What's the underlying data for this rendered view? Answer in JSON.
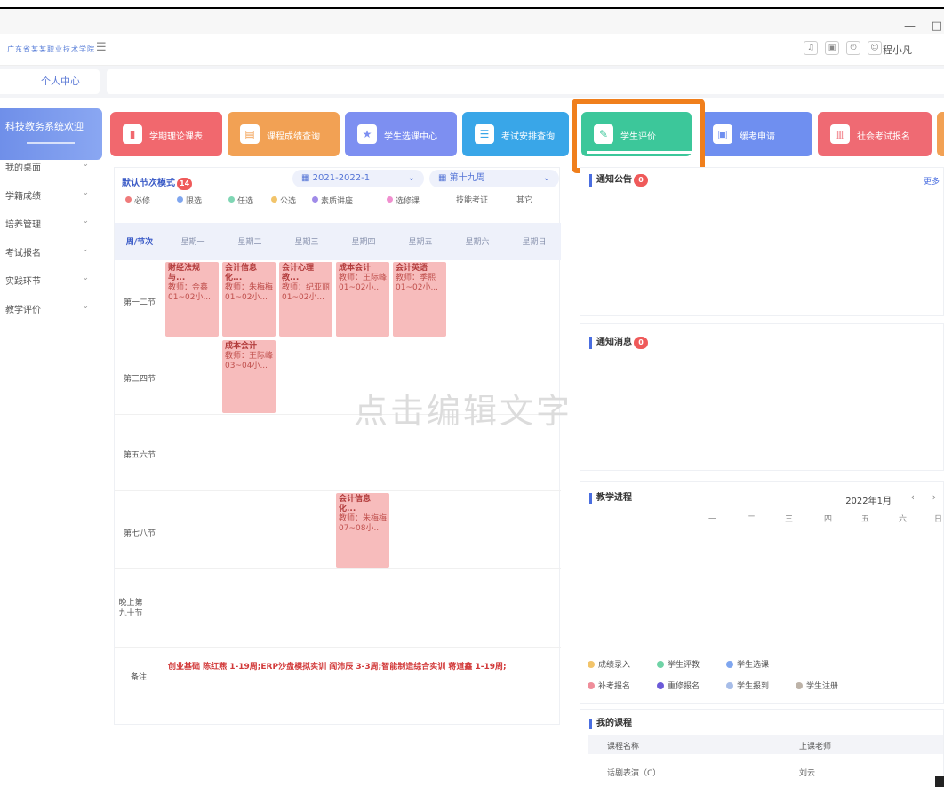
{
  "window": {
    "minimize": "—",
    "maximize": "□"
  },
  "app": {
    "logo_text": "广东省某某职业技术学院",
    "username": "程小凡",
    "toolbar_icons": [
      "bell-icon",
      "lock-icon",
      "power-icon",
      "user-icon"
    ]
  },
  "tabs": {
    "active": "个人中心"
  },
  "sidebar": {
    "banner": "科技教务系统欢迎",
    "items": [
      {
        "label": "我的桌面"
      },
      {
        "label": "学籍成绩"
      },
      {
        "label": "培养管理"
      },
      {
        "label": "考试报名"
      },
      {
        "label": "实践环节"
      },
      {
        "label": "教学评价"
      }
    ]
  },
  "shortcuts": [
    {
      "label": "学期理论课表",
      "color": "#f1686e",
      "icon": "timetable-icon"
    },
    {
      "label": "课程成绩查询",
      "color": "#f2a154",
      "icon": "grade-icon"
    },
    {
      "label": "学生选课中心",
      "color": "#7d8ff1",
      "icon": "star-icon"
    },
    {
      "label": "考试安排查询",
      "color": "#39a6e8",
      "icon": "exam-icon"
    },
    {
      "label": "学生评价",
      "color": "#3cc79a",
      "icon": "evaluate-icon"
    },
    {
      "label": "缓考申请",
      "color": "#6f8ff0",
      "icon": "defer-icon"
    },
    {
      "label": "社会考试报名",
      "color": "#ef6a73",
      "icon": "signup-icon"
    }
  ],
  "schedule": {
    "mode_label": "默认节次模式",
    "mode_badge": "14",
    "term": "2021-2022-1",
    "week": "第十九周",
    "legend": [
      {
        "label": "必修",
        "color": "#ef7b7b"
      },
      {
        "label": "限选",
        "color": "#7fa6ef"
      },
      {
        "label": "任选",
        "color": "#7fd6b4"
      },
      {
        "label": "公选",
        "color": "#f2c46a"
      },
      {
        "label": "素质讲座",
        "color": "#a08be8"
      },
      {
        "label": "选修课",
        "color": "#f08fcf"
      },
      {
        "label": "技能考证",
        "color": ""
      },
      {
        "label": "其它",
        "color": ""
      }
    ],
    "header": [
      "周/节次",
      "星期一",
      "星期二",
      "星期三",
      "星期四",
      "星期五",
      "星期六",
      "星期日"
    ],
    "periods": [
      "第一二节",
      "第三四节",
      "第五六节",
      "第七八节",
      "晚上第九十节"
    ],
    "courses": [
      {
        "name": "财经法规与...",
        "teacher": "教师：金鑫",
        "time": "01~02小..."
      },
      {
        "name": "会计信息化...",
        "teacher": "教师：朱梅梅",
        "time": "01~02小..."
      },
      {
        "name": "会计心理教...",
        "teacher": "教师：纪亚丽",
        "time": "01~02小..."
      },
      {
        "name": "成本会计",
        "teacher": "教师：王际峰",
        "time": "01~02小..."
      },
      {
        "name": "会计英语",
        "teacher": "教师：季熙",
        "time": "01~02小..."
      },
      {
        "name": "成本会计",
        "teacher": "教师：王际峰",
        "time": "03~04小..."
      },
      {
        "name": "会计信息化...",
        "teacher": "教师：朱梅梅",
        "time": "07~08小..."
      }
    ],
    "remark_label": "备注",
    "remark": "创业基础 陈红燕 1-19周;ERP沙盘模拟实训 阎沛辰 3-3周;智能制造综合实训 蒋道鑫 1-19周;"
  },
  "watermark": "点击编辑文字",
  "notice": {
    "title": "通知公告",
    "badge": "0",
    "more": "更多"
  },
  "messages": {
    "title": "通知消息",
    "badge": "0"
  },
  "progress": {
    "title": "教学进程",
    "month": "2022年1月",
    "prev": "‹",
    "next": "›",
    "weekdays": [
      "一",
      "二",
      "三",
      "四",
      "五",
      "六",
      "日"
    ],
    "legend": [
      {
        "label": "成绩录入",
        "color": "#f2c46a"
      },
      {
        "label": "学生评教",
        "color": "#6fd3a6"
      },
      {
        "label": "学生选课",
        "color": "#7fa6ef"
      },
      {
        "label": "补考报名",
        "color": "#ef8d9a"
      },
      {
        "label": "重修报名",
        "color": "#6b5ad8"
      },
      {
        "label": "学生报到",
        "color": "#a7bde8"
      },
      {
        "label": "学生注册",
        "color": "#bdb3a8"
      }
    ]
  },
  "my_courses": {
    "title": "我的课程",
    "col_name": "课程名称",
    "col_teacher": "上课老师",
    "rows": [
      {
        "name": "话剧表演（C）",
        "teacher": "刘云"
      }
    ]
  }
}
